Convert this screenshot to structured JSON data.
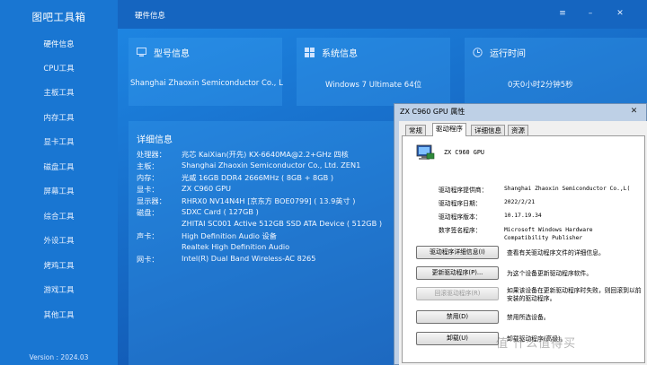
{
  "app": {
    "title": "图吧工具箱",
    "version": "Version : 2024.03"
  },
  "sidebar": {
    "items": [
      {
        "label": "硬件信息",
        "active": true
      },
      {
        "label": "CPU工具"
      },
      {
        "label": "主板工具"
      },
      {
        "label": "内存工具"
      },
      {
        "label": "显卡工具"
      },
      {
        "label": "磁盘工具"
      },
      {
        "label": "屏幕工具"
      },
      {
        "label": "综合工具"
      },
      {
        "label": "外设工具"
      },
      {
        "label": "烤鸡工具"
      },
      {
        "label": "游戏工具"
      },
      {
        "label": "其他工具"
      }
    ]
  },
  "header": {
    "title": "硬件信息",
    "menu_icon": "≡",
    "minimize_icon": "–",
    "close_icon": "✕"
  },
  "cards": {
    "model": {
      "title": "型号信息",
      "value": "Shanghai Zhaoxin Semiconductor Co., L"
    },
    "system": {
      "title": "系统信息",
      "value": "Windows 7 Ultimate 64位"
    },
    "uptime": {
      "title": "运行时间",
      "value": "0天0小时2分钟5秒"
    }
  },
  "details": {
    "title": "详细信息",
    "rows": [
      {
        "label": "处理器：",
        "value": "兆芯 KaiXian(开先) KX-6640MA@2.2+GHz 四核"
      },
      {
        "label": "主板：",
        "value": "Shanghai Zhaoxin Semiconductor Co., Ltd. ZEN1"
      },
      {
        "label": "内存：",
        "value": "光威 16GB DDR4 2666MHz ( 8GB + 8GB )"
      },
      {
        "label": "显卡：",
        "value": "ZX C960 GPU"
      },
      {
        "label": "显示器：",
        "value": "RHRX0 NV14N4H [京东方 BOE0799] ( 13.9英寸 )"
      },
      {
        "label": "磁盘：",
        "value": "SDXC Card ( 127GB )"
      },
      {
        "label": "",
        "value": "ZHITAI SC001 Active 512GB SSD ATA Device ( 512GB )"
      },
      {
        "label": "声卡：",
        "value": "High Definition Audio 设备"
      },
      {
        "label": "",
        "value": "Realtek High Definition Audio"
      },
      {
        "label": "网卡：",
        "value": "Intel(R) Dual Band Wireless-AC 8265"
      }
    ]
  },
  "dialog": {
    "title": "ZX C960 GPU 属性",
    "close_icon": "✕",
    "tabs": [
      "常规",
      "驱动程序",
      "详细信息",
      "资源"
    ],
    "active_tab": "驱动程序",
    "device_name": "ZX C960 GPU",
    "info": [
      {
        "label": "驱动程序提供商：",
        "value": "Shanghai Zhaoxin Semiconductor Co.,L("
      },
      {
        "label": "驱动程序日期：",
        "value": "2022/2/21"
      },
      {
        "label": "驱动程序版本：",
        "value": "10.17.19.34"
      },
      {
        "label": "数字签名程序：",
        "value": "Microsoft Windows Hardware Compatibility Publisher"
      }
    ],
    "buttons": [
      {
        "label": "驱动程序详细信息(I)",
        "desc": "查看有关驱动程序文件的详细信息。",
        "enabled": true
      },
      {
        "label": "更新驱动程序(P)...",
        "desc": "为这个设备更新驱动程序软件。",
        "enabled": true
      },
      {
        "label": "回滚驱动程序(R)",
        "desc": "如果该设备在更新驱动程序时失败，则回滚到以前安装的驱动程序。",
        "enabled": false
      },
      {
        "label": "禁用(D)",
        "desc": "禁用所选设备。",
        "enabled": true
      },
      {
        "label": "卸载(U)",
        "desc": "卸载驱动程序(高级)。",
        "enabled": true
      }
    ]
  },
  "watermark": "值 什么值得买"
}
